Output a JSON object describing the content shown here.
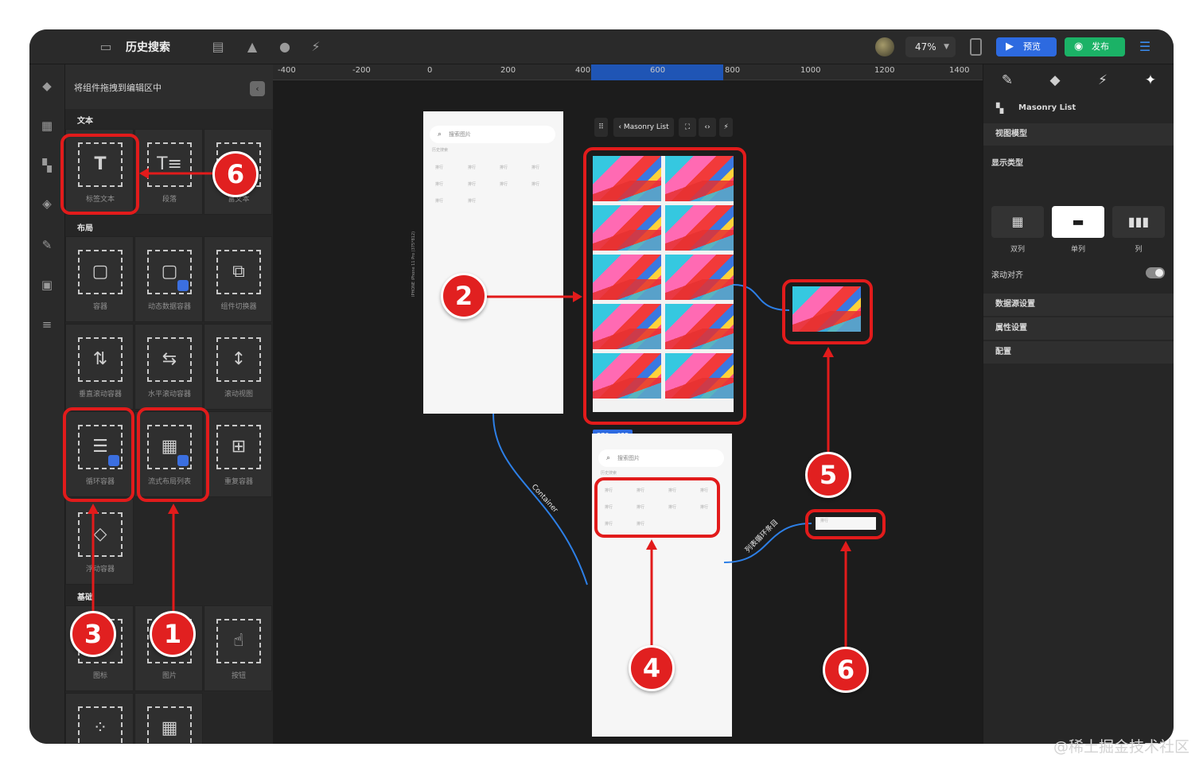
{
  "app": {
    "title": "历史搜索",
    "zoom": "47%",
    "preview_label": "预览",
    "publish_label": "发布"
  },
  "left_panel": {
    "header": "将组件拖拽到编辑区中",
    "sections": [
      {
        "title": "文本",
        "items": [
          "标签文本",
          "段落",
          "富文本"
        ]
      },
      {
        "title": "布局",
        "items": [
          "容器",
          "动态数据容器",
          "组件切换器",
          "垂直滚动容器",
          "水平滚动容器",
          "滚动视图",
          "循环容器",
          "流式布局列表",
          "重复容器",
          "浮动容器"
        ]
      },
      {
        "title": "基础",
        "items": [
          "图标",
          "图片",
          "按钮"
        ]
      }
    ]
  },
  "canvas": {
    "ruler_ticks": [
      "-400",
      "-200",
      "0",
      "200",
      "400",
      "600",
      "800",
      "1000",
      "1200",
      "1400"
    ],
    "search_placeholder": "搜索图片",
    "history_label": "历史搜索",
    "tag_text": "排行",
    "device_label": "IPHONE  iPhone 11 Pro (375*812)",
    "masonry_toolbar": "Masonry List",
    "size_badge": "376 x 685",
    "edge_label_container": "Container",
    "edge_label_item": "列表循环条目"
  },
  "right_panel": {
    "component_name": "Masonry List",
    "view_model": "视图模型",
    "display_type_label": "显示类型",
    "display_types": [
      "双列",
      "单列",
      "列"
    ],
    "scroll_align": "滚动对齐",
    "datasource": "数据源设置",
    "props": "属性设置",
    "config": "配置"
  },
  "annotations": [
    "1",
    "2",
    "3",
    "4",
    "5",
    "6",
    "6"
  ],
  "watermark": "@稀土掘金技术社区",
  "colors": {
    "accent_blue": "#2d6ae0",
    "publish_green": "#1bb266",
    "annotation_red": "#e21b1b"
  }
}
